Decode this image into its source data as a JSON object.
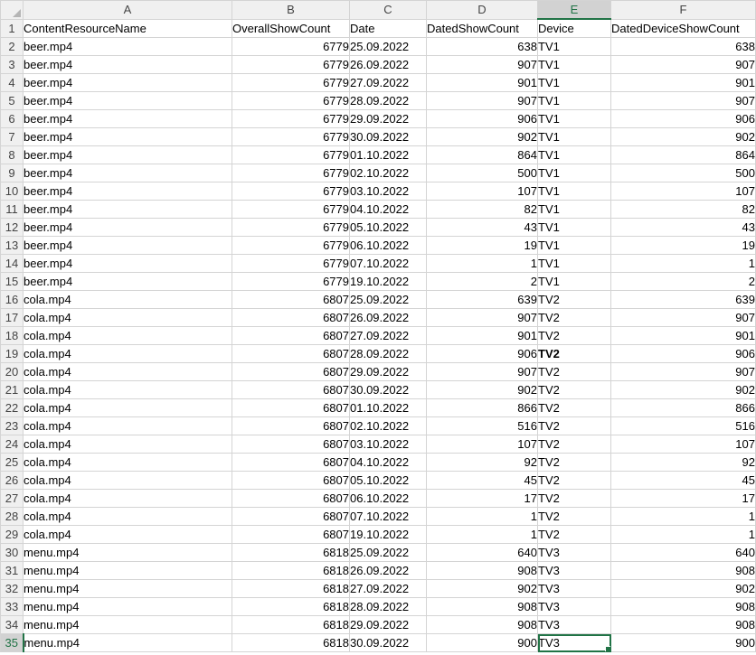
{
  "sheet": {
    "column_letters": [
      "A",
      "B",
      "C",
      "D",
      "E",
      "F"
    ],
    "active_column": "E",
    "header_row": [
      "ContentResourceName",
      "OverallShowCount",
      "Date",
      "DatedShowCount",
      "Device",
      "DatedDeviceShowCount"
    ],
    "selected_cell": "E35",
    "bold_cell": "E19",
    "rows": [
      [
        "beer.mp4",
        "6779",
        "25.09.2022",
        "638",
        "TV1",
        "638"
      ],
      [
        "beer.mp4",
        "6779",
        "26.09.2022",
        "907",
        "TV1",
        "907"
      ],
      [
        "beer.mp4",
        "6779",
        "27.09.2022",
        "901",
        "TV1",
        "901"
      ],
      [
        "beer.mp4",
        "6779",
        "28.09.2022",
        "907",
        "TV1",
        "907"
      ],
      [
        "beer.mp4",
        "6779",
        "29.09.2022",
        "906",
        "TV1",
        "906"
      ],
      [
        "beer.mp4",
        "6779",
        "30.09.2022",
        "902",
        "TV1",
        "902"
      ],
      [
        "beer.mp4",
        "6779",
        "01.10.2022",
        "864",
        "TV1",
        "864"
      ],
      [
        "beer.mp4",
        "6779",
        "02.10.2022",
        "500",
        "TV1",
        "500"
      ],
      [
        "beer.mp4",
        "6779",
        "03.10.2022",
        "107",
        "TV1",
        "107"
      ],
      [
        "beer.mp4",
        "6779",
        "04.10.2022",
        "82",
        "TV1",
        "82"
      ],
      [
        "beer.mp4",
        "6779",
        "05.10.2022",
        "43",
        "TV1",
        "43"
      ],
      [
        "beer.mp4",
        "6779",
        "06.10.2022",
        "19",
        "TV1",
        "19"
      ],
      [
        "beer.mp4",
        "6779",
        "07.10.2022",
        "1",
        "TV1",
        "1"
      ],
      [
        "beer.mp4",
        "6779",
        "19.10.2022",
        "2",
        "TV1",
        "2"
      ],
      [
        "cola.mp4",
        "6807",
        "25.09.2022",
        "639",
        "TV2",
        "639"
      ],
      [
        "cola.mp4",
        "6807",
        "26.09.2022",
        "907",
        "TV2",
        "907"
      ],
      [
        "cola.mp4",
        "6807",
        "27.09.2022",
        "901",
        "TV2",
        "901"
      ],
      [
        "cola.mp4",
        "6807",
        "28.09.2022",
        "906",
        "TV2",
        "906"
      ],
      [
        "cola.mp4",
        "6807",
        "29.09.2022",
        "907",
        "TV2",
        "907"
      ],
      [
        "cola.mp4",
        "6807",
        "30.09.2022",
        "902",
        "TV2",
        "902"
      ],
      [
        "cola.mp4",
        "6807",
        "01.10.2022",
        "866",
        "TV2",
        "866"
      ],
      [
        "cola.mp4",
        "6807",
        "02.10.2022",
        "516",
        "TV2",
        "516"
      ],
      [
        "cola.mp4",
        "6807",
        "03.10.2022",
        "107",
        "TV2",
        "107"
      ],
      [
        "cola.mp4",
        "6807",
        "04.10.2022",
        "92",
        "TV2",
        "92"
      ],
      [
        "cola.mp4",
        "6807",
        "05.10.2022",
        "45",
        "TV2",
        "45"
      ],
      [
        "cola.mp4",
        "6807",
        "06.10.2022",
        "17",
        "TV2",
        "17"
      ],
      [
        "cola.mp4",
        "6807",
        "07.10.2022",
        "1",
        "TV2",
        "1"
      ],
      [
        "cola.mp4",
        "6807",
        "19.10.2022",
        "1",
        "TV2",
        "1"
      ],
      [
        "menu.mp4",
        "6818",
        "25.09.2022",
        "640",
        "TV3",
        "640"
      ],
      [
        "menu.mp4",
        "6818",
        "26.09.2022",
        "908",
        "TV3",
        "908"
      ],
      [
        "menu.mp4",
        "6818",
        "27.09.2022",
        "902",
        "TV3",
        "902"
      ],
      [
        "menu.mp4",
        "6818",
        "28.09.2022",
        "908",
        "TV3",
        "908"
      ],
      [
        "menu.mp4",
        "6818",
        "29.09.2022",
        "908",
        "TV3",
        "908"
      ],
      [
        "menu.mp4",
        "6818",
        "30.09.2022",
        "900",
        "TV3",
        "900"
      ]
    ]
  }
}
